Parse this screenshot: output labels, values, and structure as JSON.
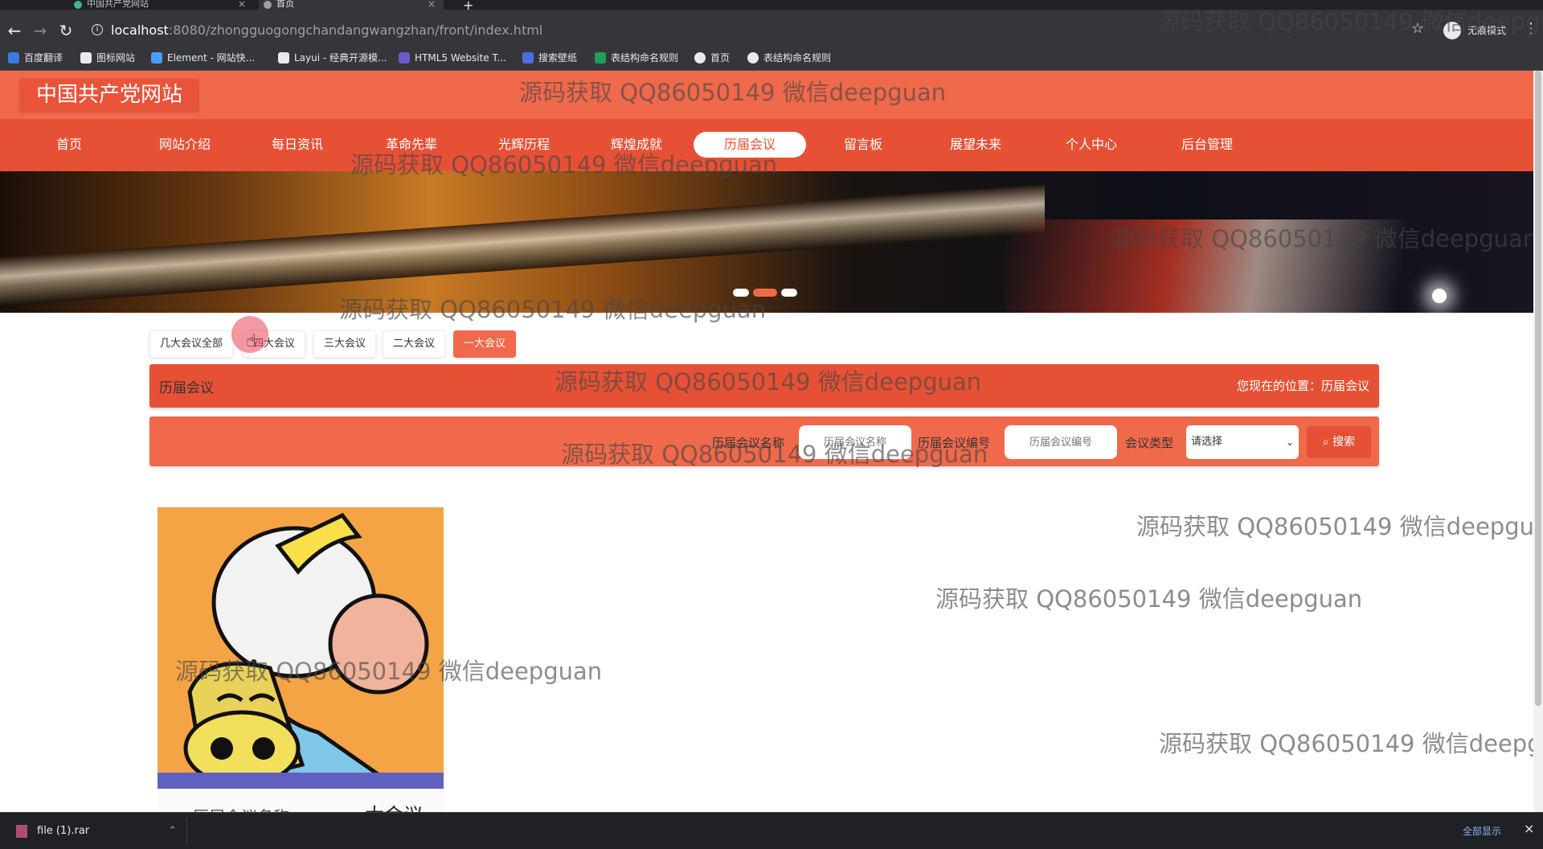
{
  "browser": {
    "tabs": [
      {
        "title": "中国共产党网站",
        "active": false
      },
      {
        "title": "首页",
        "active": true
      }
    ],
    "new_tab": "+",
    "url_host": "localhost",
    "url_rest": ":8080/zhongguogongchandangwangzhan/front/index.html",
    "incognito_label": "无痕模式",
    "bookmarks": [
      {
        "label": "百度翻译",
        "icon_color": "#3b7ae0"
      },
      {
        "label": "图标网站",
        "icon_color": "#e8eaed"
      },
      {
        "label": "Element - 网站快...",
        "icon_color": "#4a9eff"
      },
      {
        "label": "Layui - 经典开源模...",
        "icon_color": "#e8eaed"
      },
      {
        "label": "HTML5 Website T...",
        "icon_color": "#6a5acd"
      },
      {
        "label": "搜索壁纸",
        "icon_color": "#4a6ee0"
      },
      {
        "label": "表结构命名规则",
        "icon_color": "#1e9e5a"
      },
      {
        "label": "首页",
        "icon_color": "#e8eaed"
      },
      {
        "label": "表结构命名规则",
        "icon_color": "#e8eaed"
      }
    ]
  },
  "site": {
    "logo": "中国共产党网站",
    "nav": [
      "首页",
      "网站介绍",
      "每日资讯",
      "革命先辈",
      "光辉历程",
      "辉煌成就",
      "历届会议",
      "留言板",
      "展望未来",
      "个人中心",
      "后台管理"
    ],
    "nav_active": "历届会议",
    "accent": "#e65135",
    "header_color": "#f0694b"
  },
  "banner": {
    "dots": 3,
    "active_dot": 1
  },
  "filters": {
    "buttons": [
      "几大会议全部",
      "四大会议",
      "三大会议",
      "二大会议",
      "一大会议"
    ],
    "active": "一大会议"
  },
  "title_bar": {
    "title": "历届会议",
    "location_label": "您现在的位置：",
    "location_value": "历届会议"
  },
  "search": {
    "name_label": "历届会议名称",
    "name_placeholder": "历届会议名称",
    "code_label": "历届会议编号",
    "code_placeholder": "历届会议编号",
    "type_label": "会议类型",
    "type_selected": "请选择",
    "button_label": "搜索"
  },
  "card": {
    "label": "历届会议名称：",
    "value": "一大会议"
  },
  "watermark": "源码获取 QQ86050149 微信deepguan",
  "download": {
    "file": "file (1).rar",
    "show_all": "全部显示"
  }
}
